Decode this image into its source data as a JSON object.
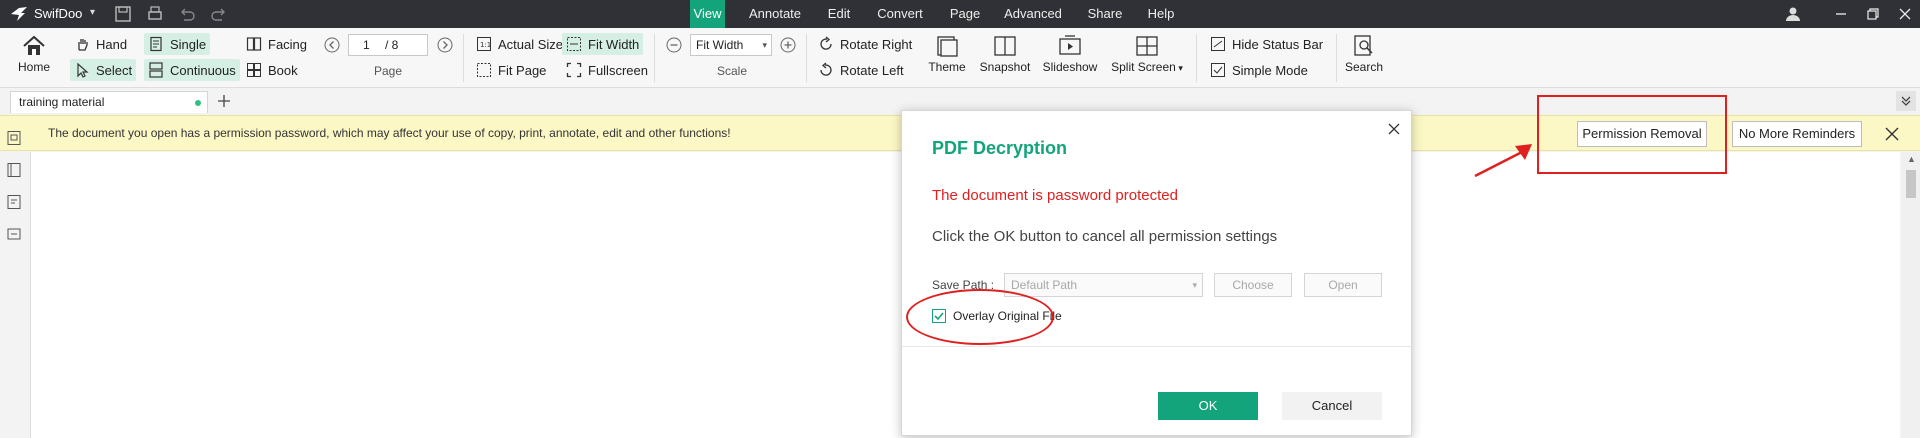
{
  "app": {
    "name": "SwifDoo"
  },
  "menu": [
    {
      "label": "View",
      "active": true
    },
    {
      "label": "Annotate"
    },
    {
      "label": "Edit"
    },
    {
      "label": "Convert"
    },
    {
      "label": "Page"
    },
    {
      "label": "Advanced"
    },
    {
      "label": "Share"
    },
    {
      "label": "Help"
    }
  ],
  "ribbon": {
    "home": "Home",
    "hand": "Hand",
    "select": "Select",
    "single": "Single",
    "continuous": "Continuous",
    "facing": "Facing",
    "book": "Book",
    "page_current": "1",
    "page_total": "/ 8",
    "page_label": "Page",
    "actual_size": "Actual Size",
    "fit_width": "Fit Width",
    "fit_page": "Fit Page",
    "fullscreen": "Fullscreen",
    "scale_value": "Fit Width",
    "scale_label": "Scale",
    "rotate_right": "Rotate Right",
    "rotate_left": "Rotate Left",
    "theme": "Theme",
    "snapshot": "Snapshot",
    "slideshow": "Slideshow",
    "split_screen": "Split Screen",
    "hide_status_bar": "Hide Status Bar",
    "simple_mode": "Simple Mode",
    "search": "Search"
  },
  "tabs": [
    {
      "label": "training material"
    }
  ],
  "banner": {
    "message": "The document you open has a permission password, which may affect your use of copy, print, annotate, edit and other functions!",
    "permission_removal": "Permission Removal",
    "no_more_reminders": "No More Reminders"
  },
  "dialog": {
    "title": "PDF Decryption",
    "warning": "The document is password protected",
    "info": "Click the OK button to cancel all permission settings",
    "save_path_label": "Save Path :",
    "save_path_value": "Default Path",
    "choose": "Choose",
    "open": "Open",
    "overlay_label": "Overlay Original File",
    "overlay_checked": true,
    "ok": "OK",
    "cancel": "Cancel"
  },
  "colors": {
    "accent": "#13a47c",
    "annotation": "#e02020",
    "banner": "#fcf8c6",
    "titlebar": "#2f3136"
  }
}
